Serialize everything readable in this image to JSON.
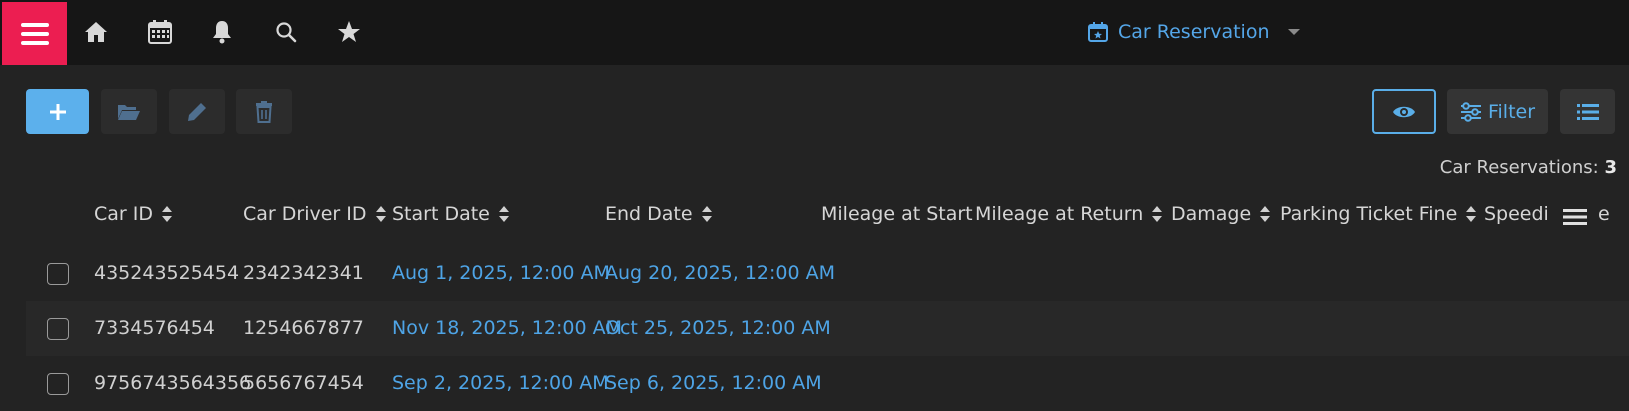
{
  "app": {
    "title": "Car Reservation"
  },
  "toolbar": {
    "filter_label": "Filter"
  },
  "summary": {
    "label": "Car Reservations:",
    "count": "3"
  },
  "table": {
    "headers": [
      "Car ID",
      "Car Driver ID",
      "Start Date",
      "End Date",
      "Mileage at Start",
      "Mileage at Return",
      "Damage",
      "Parking Ticket Fine",
      "Speedi",
      "e"
    ],
    "rows": [
      [
        "435243525454",
        "2342342341",
        "Aug 1, 2025, 12:00 AM",
        "Aug 20, 2025, 12:00 AM"
      ],
      [
        "7334576454",
        "1254667877",
        "Nov 18, 2025, 12:00 AM",
        "Oct 25, 2025, 12:00 AM"
      ],
      [
        "9756743564356",
        "5656767454",
        "Sep 2, 2025, 12:00 AM",
        "Sep 6, 2025, 12:00 AM"
      ]
    ]
  },
  "colors": {
    "accent": "#54a6e8",
    "menu": "#ec1e51",
    "background": "#232323",
    "topbar": "#161616"
  },
  "icons": [
    "menu-icon",
    "home-icon",
    "calendar-icon",
    "bell-icon",
    "search-icon",
    "star-icon",
    "calendar-star-icon",
    "chevron-down-icon",
    "plus-icon",
    "folder-open-icon",
    "pencil-icon",
    "trash-icon",
    "eye-icon",
    "filter-sliders-icon",
    "list-icon",
    "sort-icon",
    "column-menu-icon"
  ]
}
